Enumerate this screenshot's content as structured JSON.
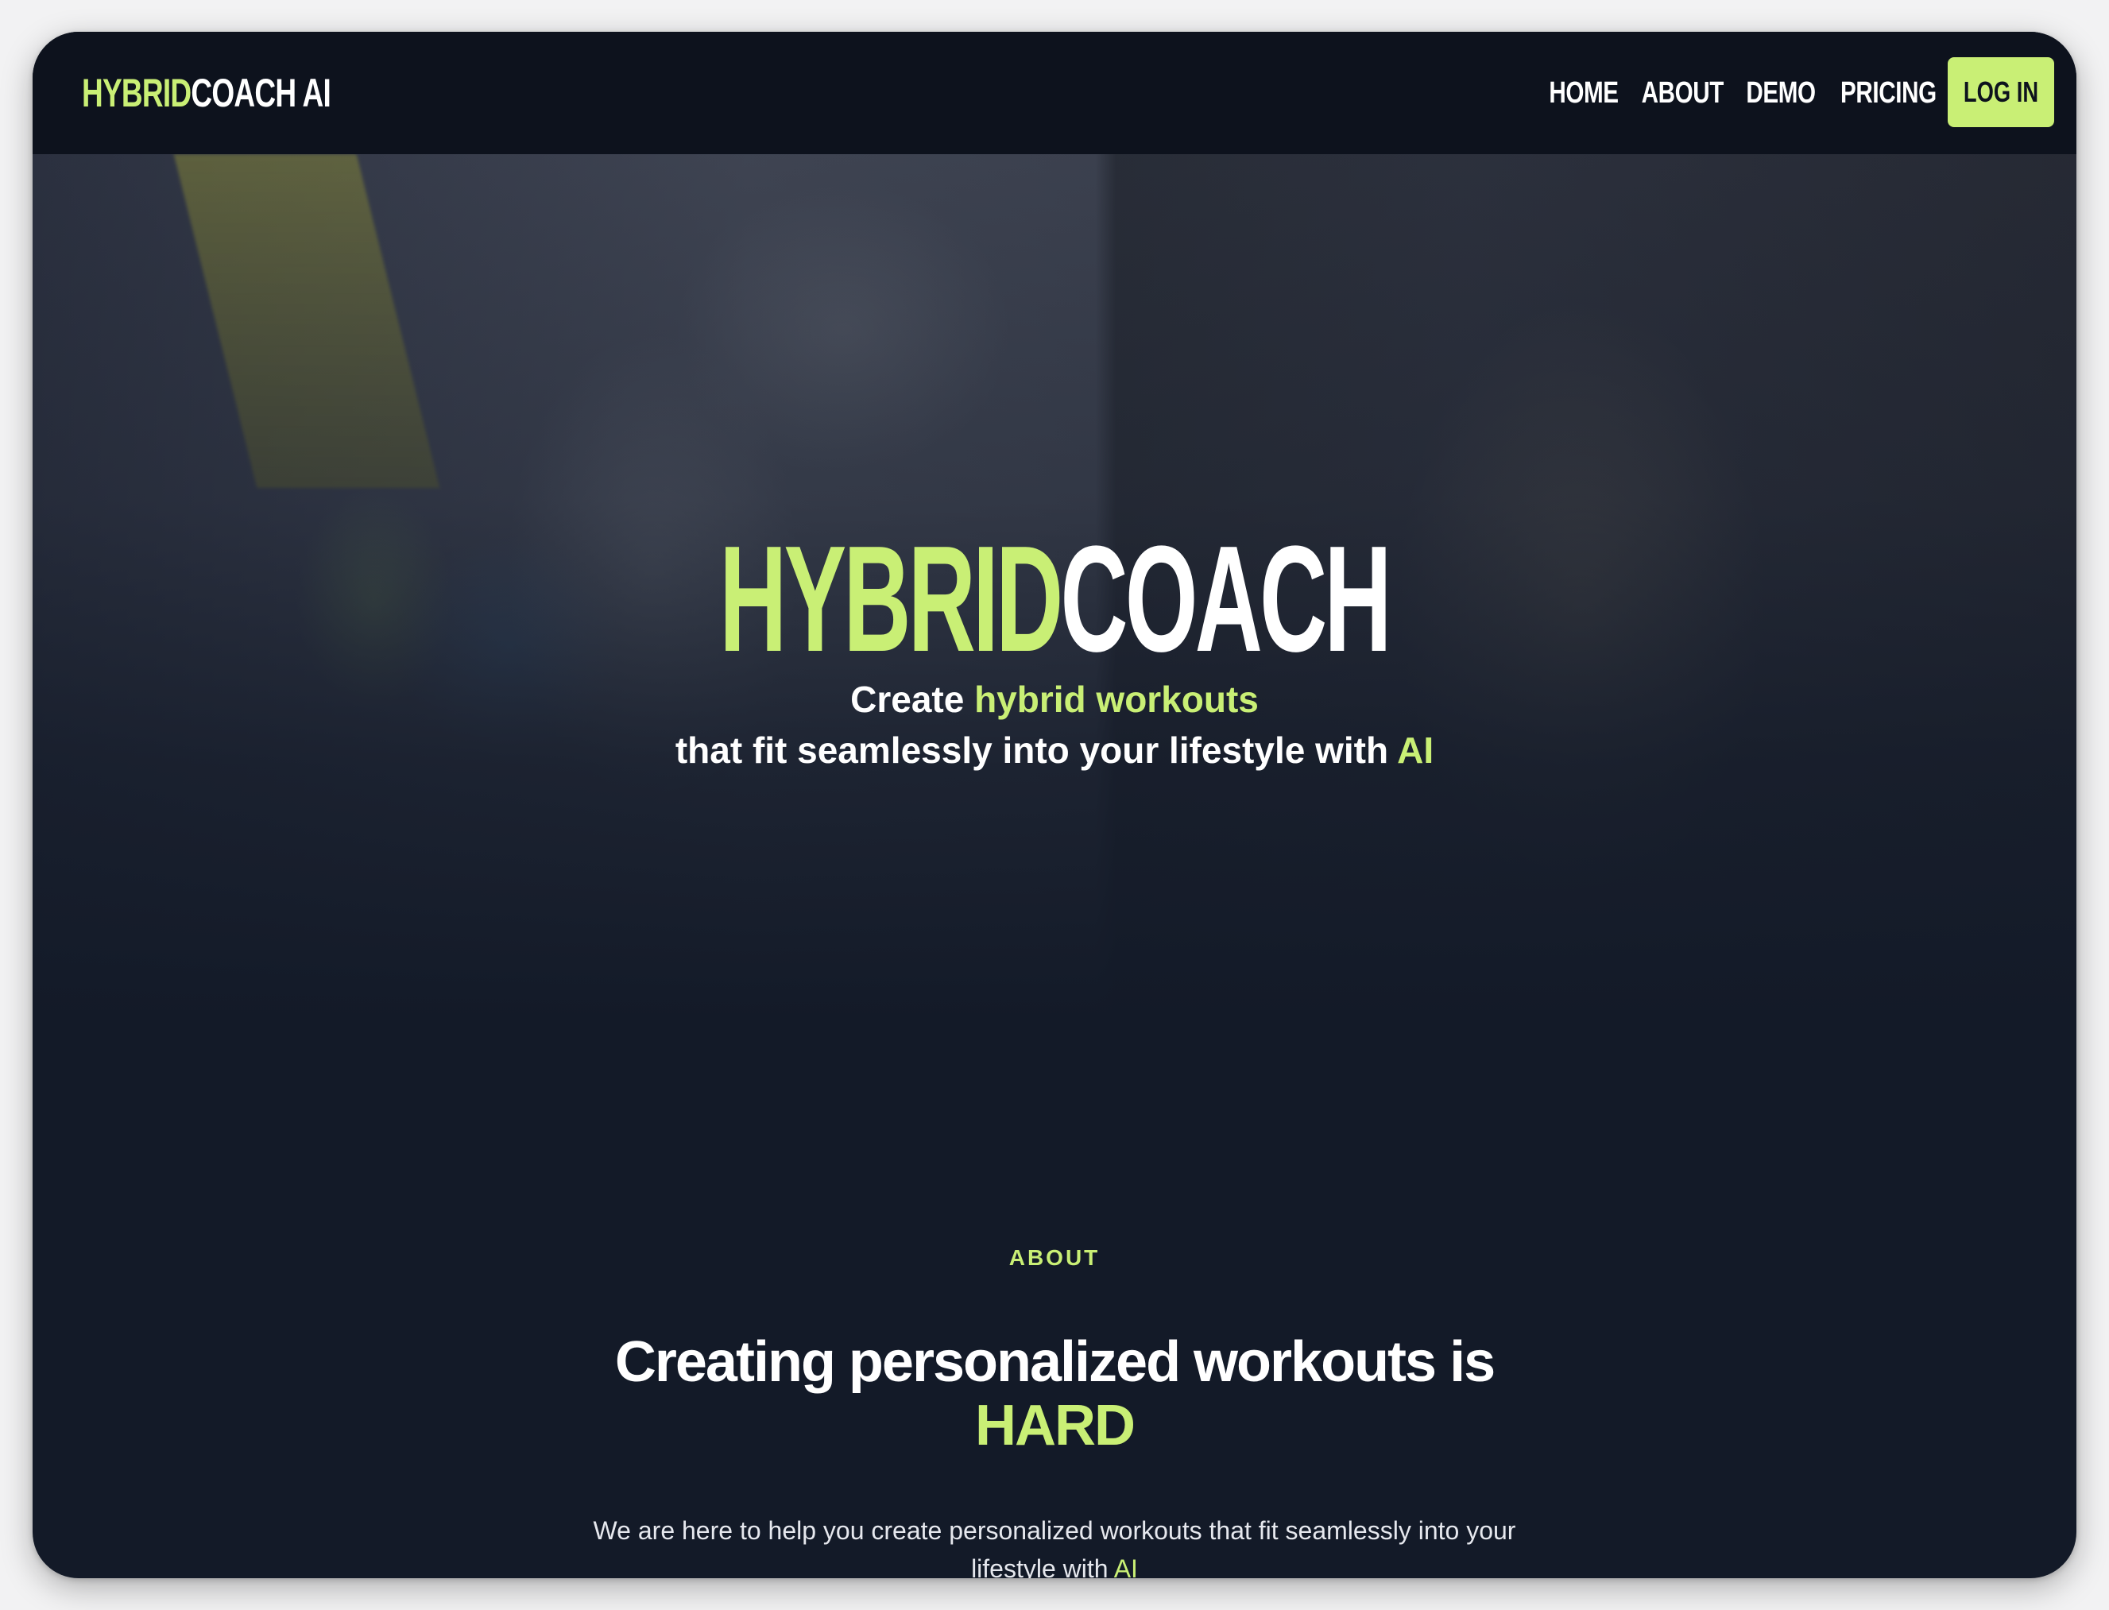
{
  "nav": {
    "logo_accent": "HYBRID",
    "logo_rest": "COACH AI",
    "links": [
      "HOME",
      "ABOUT",
      "DEMO",
      "PRICING"
    ],
    "login_label": "LOG IN"
  },
  "hero": {
    "title_accent": "HYBRID",
    "title_rest": "COACH",
    "sub_line1_prefix": "Create ",
    "sub_line1_accent": "hybrid workouts",
    "sub_line2_prefix": "that fit seamlessly into your lifestyle with ",
    "sub_line2_accent": "AI"
  },
  "about": {
    "eyebrow": "ABOUT",
    "heading": "Creating personalized workouts is",
    "heading_accent": "HARD",
    "body_line1": "We are here to help you create personalized workouts that fit seamlessly into your",
    "body_line2_prefix": "lifestyle with ",
    "body_line2_accent": "AI"
  },
  "colors": {
    "accent": "#c9ef75",
    "nav_bg": "#0d121d",
    "page_bg": "#131a28",
    "text": "#ffffff"
  }
}
